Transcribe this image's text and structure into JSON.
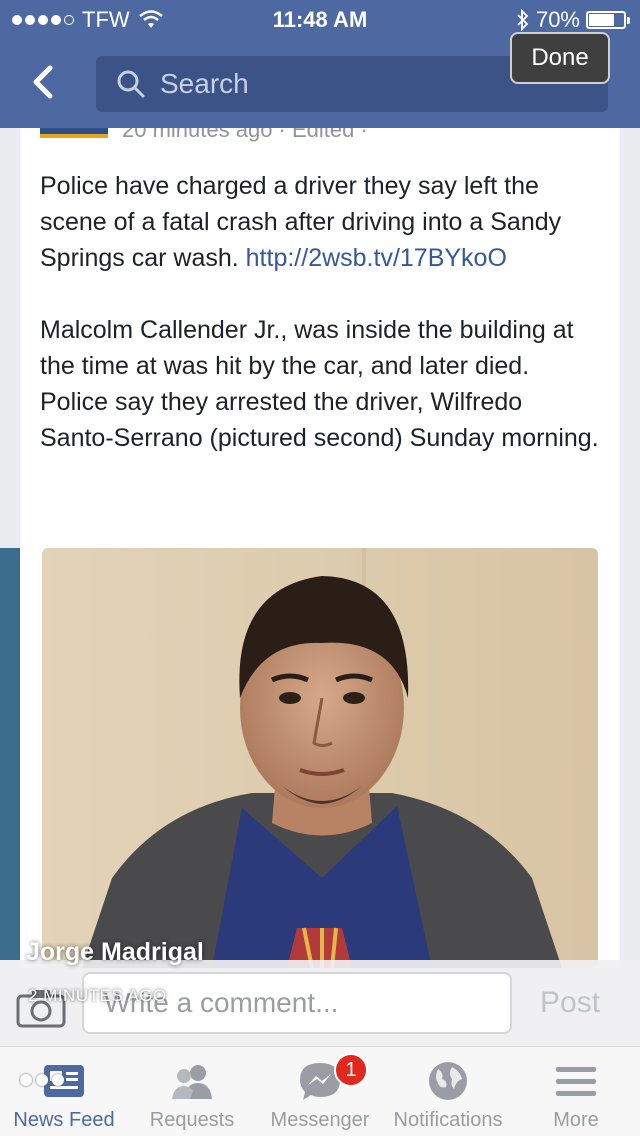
{
  "status_bar": {
    "carrier": "TFW",
    "time": "11:48 AM",
    "battery": "70%",
    "battery_level": 0.7
  },
  "nav": {
    "search_placeholder": "Search",
    "done_label": "Done"
  },
  "post": {
    "meta": "20 minutes ago · Edited ·",
    "paragraph1": "Police have charged a driver they say left the scene of a fatal crash after driving into a Sandy Springs car wash.",
    "link": "http://2wsb.tv/17BYkoO",
    "paragraph2": "Malcolm Callender Jr., was inside the building at the time at was hit by the car, and later died. Police say they arrested the driver, Wilfredo Santo-Serrano (pictured second) Sunday morning."
  },
  "overlay": {
    "name": "Jorge Madrigal",
    "time": "2 MINUTES AGO"
  },
  "comment": {
    "placeholder": "Write a comment...",
    "post_label": "Post"
  },
  "tabs": [
    {
      "label": "News Feed",
      "icon": "news-feed-icon",
      "active": true
    },
    {
      "label": "Requests",
      "icon": "friend-requests-icon"
    },
    {
      "label": "Messenger",
      "icon": "messenger-icon",
      "badge": "1"
    },
    {
      "label": "Notifications",
      "icon": "globe-icon"
    },
    {
      "label": "More",
      "icon": "menu-icon"
    }
  ],
  "colors": {
    "facebook_blue": "#4e69a2",
    "link_blue": "#365899",
    "badge_red": "#e0281f"
  }
}
